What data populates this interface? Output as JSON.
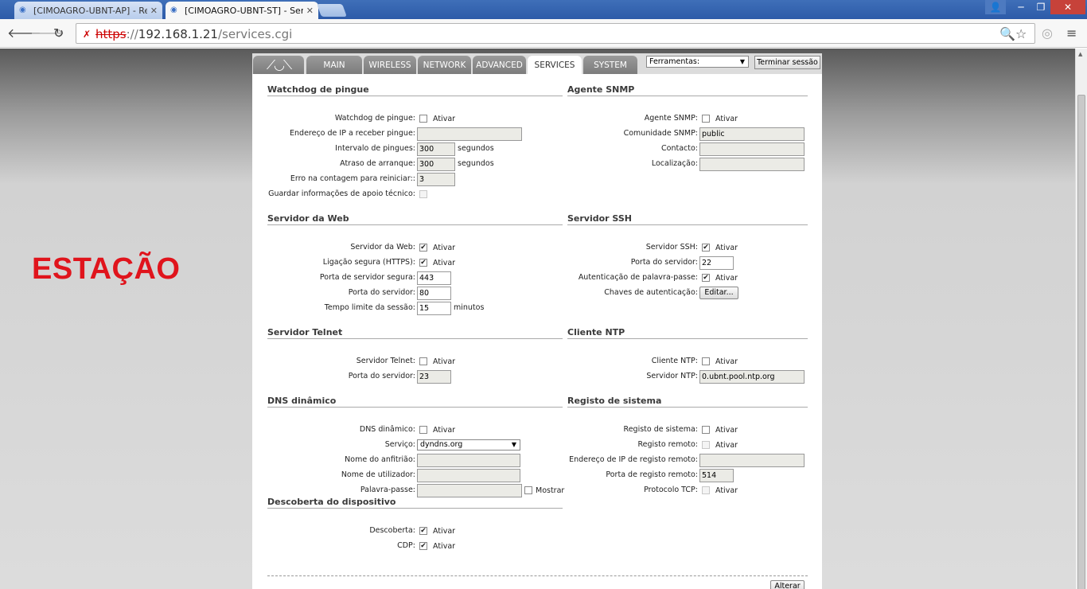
{
  "browser": {
    "tabs": [
      {
        "title": "[CIMOAGRO-UBNT-AP] - Rec",
        "icon": "wifi-icon"
      },
      {
        "title": "[CIMOAGRO-UBNT-ST] - Ser",
        "icon": "wifi-icon"
      }
    ],
    "url": {
      "protocol": "https",
      "sep": "://",
      "host": "192.168.1.21",
      "path": "/services.cgi"
    }
  },
  "overlay_label": "ESTAÇÃO",
  "ubnt": {
    "tabs": [
      "MAIN",
      "WIRELESS",
      "NETWORK",
      "ADVANCED",
      "SERVICES",
      "SYSTEM"
    ],
    "active_tab": "SERVICES",
    "tools_select": "Ferramentas:",
    "logout": "Terminar sessão",
    "apply": "Alterar",
    "ativar": "Ativar",
    "watchdog": {
      "title": "Watchdog de pingue",
      "enable_label": "Watchdog de pingue:",
      "ip_label": "Endereço de IP a receber pingue:",
      "ip_value": "",
      "interval_label": "Intervalo de pingues:",
      "interval_value": "300",
      "seconds": "segundos",
      "delay_label": "Atraso de arranque:",
      "delay_value": "300",
      "fail_label": "Erro na contagem para reiniciar::",
      "fail_value": "3",
      "support_label": "Guardar informações de apoio técnico:"
    },
    "snmp": {
      "title": "Agente SNMP",
      "enable_label": "Agente SNMP:",
      "community_label": "Comunidade SNMP:",
      "community_value": "public",
      "contact_label": "Contacto:",
      "contact_value": "",
      "location_label": "Localização:",
      "location_value": ""
    },
    "web": {
      "title": "Servidor da Web",
      "enable_label": "Servidor da Web:",
      "https_label": "Ligação segura (HTTPS):",
      "secure_port_label": "Porta de servidor segura:",
      "secure_port_value": "443",
      "port_label": "Porta do servidor:",
      "port_value": "80",
      "timeout_label": "Tempo limite da sessão:",
      "timeout_value": "15",
      "minutes": "minutos"
    },
    "ssh": {
      "title": "Servidor SSH",
      "enable_label": "Servidor SSH:",
      "port_label": "Porta do servidor:",
      "port_value": "22",
      "pw_auth_label": "Autenticação de palavra-passe:",
      "keys_label": "Chaves de autenticação:",
      "edit_button": "Editar..."
    },
    "telnet": {
      "title": "Servidor Telnet",
      "enable_label": "Servidor Telnet:",
      "port_label": "Porta do servidor:",
      "port_value": "23"
    },
    "ntp": {
      "title": "Cliente NTP",
      "enable_label": "Cliente NTP:",
      "server_label": "Servidor NTP:",
      "server_value": "0.ubnt.pool.ntp.org"
    },
    "ddns": {
      "title": "DNS dinâmico",
      "enable_label": "DNS dinâmico:",
      "service_label": "Serviço:",
      "service_value": "dyndns.org",
      "host_label": "Nome do anfitrião:",
      "user_label": "Nome de utilizador:",
      "pass_label": "Palavra-passe:",
      "show_label": "Mostrar"
    },
    "syslog": {
      "title": "Registo de sistema",
      "enable_label": "Registo de sistema:",
      "remote_label": "Registo remoto:",
      "remote_ip_label": "Endereço de IP de registo remoto:",
      "remote_port_label": "Porta de registo remoto:",
      "remote_port_value": "514",
      "tcp_label": "Protocolo TCP:"
    },
    "discovery": {
      "title": "Descoberta do dispositivo",
      "enable_label": "Descoberta:",
      "cdp_label": "CDP:"
    }
  }
}
